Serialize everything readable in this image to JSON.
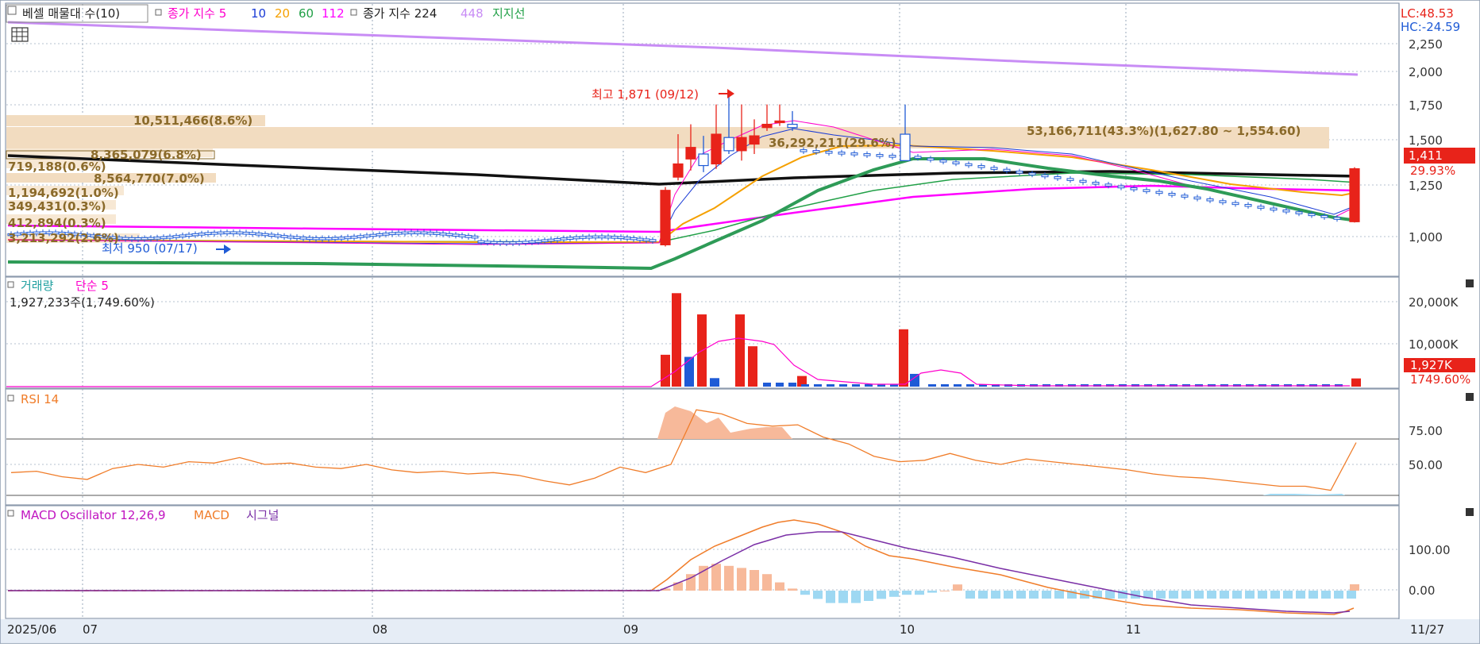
{
  "colors": {
    "up": "#e8231a",
    "down": "#1f5bd6",
    "ma5": "#ff00cc",
    "ma10": "#1a3bd6",
    "ma20": "#f5a000",
    "ma60": "#21a047",
    "ma112": "#ff00ff",
    "ma224": "#111111",
    "ma448": "#c88cf5",
    "support": "#2e9b57",
    "grid": "#9aa8bb",
    "bg": "#ffffff",
    "axis_bg": "#e6edf6",
    "profile": "#f2dcc0",
    "profile_text": "#8a6a2a",
    "rsi": "#f07d2a",
    "macd": "#f07d2a",
    "signal": "#7a2fa6",
    "osc_pos": "#f7b99a",
    "osc_neg": "#9ed8f2"
  },
  "legend": {
    "profile_label": "베셀 매물대 수(10)",
    "ma_group1_label": "종가 지수 5",
    "ma10": "10",
    "ma20": "20",
    "ma60": "60",
    "ma112": "112",
    "ma_group2_label": "종가 지수 224",
    "ma448": "448",
    "support": "지지선"
  },
  "price_panel": {
    "lc": "LC:48.53",
    "hc": "HC:-24.59",
    "current_price": "1,411",
    "current_change": "29.93%",
    "high_label": "최고 1,871 (09/12)",
    "low_label": "최저 950 (07/17)"
  },
  "profile_labels": [
    "10,511,466(8.6%)",
    "8,365,079(6.8%)",
    "719,188(0.6%)",
    "8,564,770(7.0%)",
    "1,194,692(1.0%)",
    "349,431(0.3%)",
    "412,894(0.3%)",
    "3,213,292(2.6%)",
    "53,166,711(43.3%)(1,627.80 ~ 1,554.60)",
    "36,292,211(29.6%)"
  ],
  "volume_panel": {
    "label": "거래량",
    "ma_label": "단순 5",
    "summary": "1,927,233주(1,749.60%)",
    "current_value": "1,927K",
    "current_pct": "1749.60%",
    "ticks": [
      "20,000K",
      "10,000K"
    ]
  },
  "rsi_panel": {
    "label": "RSI 14",
    "ticks": [
      "75.00",
      "50.00"
    ]
  },
  "macd_panel": {
    "label": "MACD Oscillator 12,26,9",
    "macd_label": "MACD",
    "signal_label": "시그널",
    "ticks": [
      "100.00",
      "0.00"
    ]
  },
  "x_axis": {
    "labels": [
      "2025/06",
      "07",
      "08",
      "09",
      "10",
      "11"
    ],
    "end_label": "11/27"
  },
  "chart_data": [
    {
      "type": "candlestick",
      "title": "베셀 매물대 수(10)",
      "x_label_ticks": [
        "2025/06",
        "07",
        "08",
        "09",
        "10",
        "11",
        "11/27"
      ],
      "ylim": [
        880,
        2450
      ],
      "y_ticks": [
        1000,
        1250,
        1500,
        1750,
        2000,
        2250
      ],
      "ohlc": [
        {
          "date": "09/05",
          "open": 950,
          "high": 1300,
          "low": 940,
          "close": 1280
        },
        {
          "date": "09/08",
          "open": 1360,
          "high": 1620,
          "low": 1340,
          "close": 1440
        },
        {
          "date": "09/09",
          "open": 1470,
          "high": 1680,
          "low": 1400,
          "close": 1540
        },
        {
          "date": "09/10",
          "open": 1500,
          "high": 1610,
          "low": 1390,
          "close": 1430
        },
        {
          "date": "09/11",
          "open": 1440,
          "high": 1800,
          "low": 1410,
          "close": 1620
        },
        {
          "date": "09/12",
          "open": 1600,
          "high": 1871,
          "low": 1500,
          "close": 1520
        },
        {
          "date": "09/15",
          "open": 1520,
          "high": 1800,
          "low": 1460,
          "close": 1600
        },
        {
          "date": "09/16",
          "open": 1560,
          "high": 1710,
          "low": 1500,
          "close": 1610
        },
        {
          "date": "09/17",
          "open": 1660,
          "high": 1800,
          "low": 1640,
          "close": 1680
        },
        {
          "date": "09/18",
          "open": 1690,
          "high": 1800,
          "low": 1670,
          "close": 1700
        },
        {
          "date": "09/19",
          "open": 1680,
          "high": 1760,
          "low": 1640,
          "close": 1660
        },
        {
          "date": "10/01",
          "open": 1620,
          "high": 1800,
          "low": 1520,
          "close": 1460
        },
        {
          "date": "11/27",
          "open": 1090,
          "high": 1420,
          "low": 1085,
          "close": 1411
        }
      ],
      "high": {
        "date": "09/12",
        "value": 1871
      },
      "low": {
        "date": "07/17",
        "value": 950
      },
      "current": 1411,
      "change_pct": 29.93
    },
    {
      "type": "bar",
      "title": "거래량",
      "unit": "K",
      "ylim": [
        0,
        25000
      ],
      "y_ticks": [
        10000,
        20000
      ],
      "series": [
        {
          "name": "거래량",
          "values": [
            7500,
            22000,
            7000,
            17000,
            2000,
            17000,
            9500,
            2500,
            13500,
            3000,
            1927
          ]
        }
      ],
      "current": 1927,
      "current_pct": 1749.6
    },
    {
      "type": "line",
      "title": "RSI 14",
      "ylim": [
        20,
        100
      ],
      "y_ticks": [
        50,
        75
      ],
      "reference_lines": [
        70,
        30
      ],
      "series": [
        {
          "name": "RSI 14",
          "values": [
            44,
            45,
            41,
            39,
            47,
            50,
            48,
            52,
            51,
            55,
            50,
            51,
            48,
            47,
            50,
            46,
            44,
            45,
            43,
            44,
            42,
            38,
            35,
            40,
            48,
            44,
            50,
            90,
            87,
            80,
            78,
            79,
            70,
            65,
            56,
            52,
            53,
            58,
            53,
            50,
            54,
            52,
            50,
            48,
            46,
            43,
            41,
            40,
            38,
            36,
            34,
            34,
            31,
            66
          ]
        }
      ],
      "current": 66
    },
    {
      "type": "line",
      "title": "MACD Oscillator 12,26,9",
      "ylim": [
        -40,
        200
      ],
      "y_ticks": [
        0,
        100
      ],
      "series": [
        {
          "name": "MACD",
          "values": [
            0,
            0,
            0,
            0,
            0,
            0,
            0,
            0,
            10,
            50,
            95,
            125,
            150,
            170,
            175,
            160,
            115,
            90,
            80,
            60,
            40,
            10,
            -15,
            -30,
            -50,
            -60
          ]
        },
        {
          "name": "시그널",
          "values": [
            0,
            0,
            0,
            0,
            0,
            0,
            0,
            0,
            5,
            30,
            60,
            95,
            125,
            145,
            150,
            140,
            120,
            105,
            90,
            70,
            50,
            25,
            0,
            -20,
            -45,
            -55
          ]
        }
      ],
      "oscillator": [
        5,
        20,
        40,
        60,
        65,
        60,
        55,
        50,
        40,
        20,
        5,
        -10,
        -20,
        -30,
        -30,
        -30,
        -25,
        -20,
        -15,
        -10,
        -10,
        -5,
        0,
        15
      ]
    }
  ]
}
